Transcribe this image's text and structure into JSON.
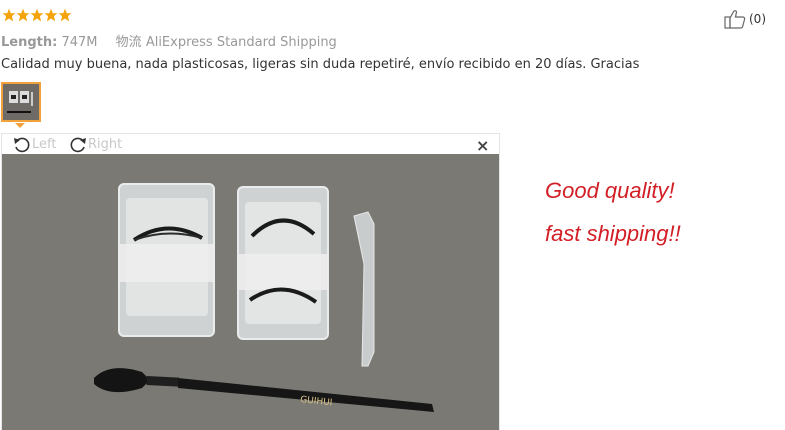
{
  "rating": {
    "stars": 5,
    "max": 5,
    "color": "#f5a30a"
  },
  "like": {
    "count": "(0)",
    "icon": "thumbs-up-icon"
  },
  "meta": {
    "length_label": "Length:",
    "length_value": "747M",
    "shipping_label": "物流",
    "shipping_value": "AliExpress Standard Shipping"
  },
  "review": {
    "text": "Calidad muy buena, nada plasticosas, ligeras sin duda repetiré, envío recibido en 20 días. Gracias"
  },
  "viewer": {
    "rotate_left_label": "Left",
    "rotate_right_label": "Right",
    "close_label": "×",
    "brush_brand": "GUIHUI"
  },
  "overlay": {
    "line1": "Good quality!",
    "line2": "fast shipping!!",
    "color": "#d21f26"
  }
}
